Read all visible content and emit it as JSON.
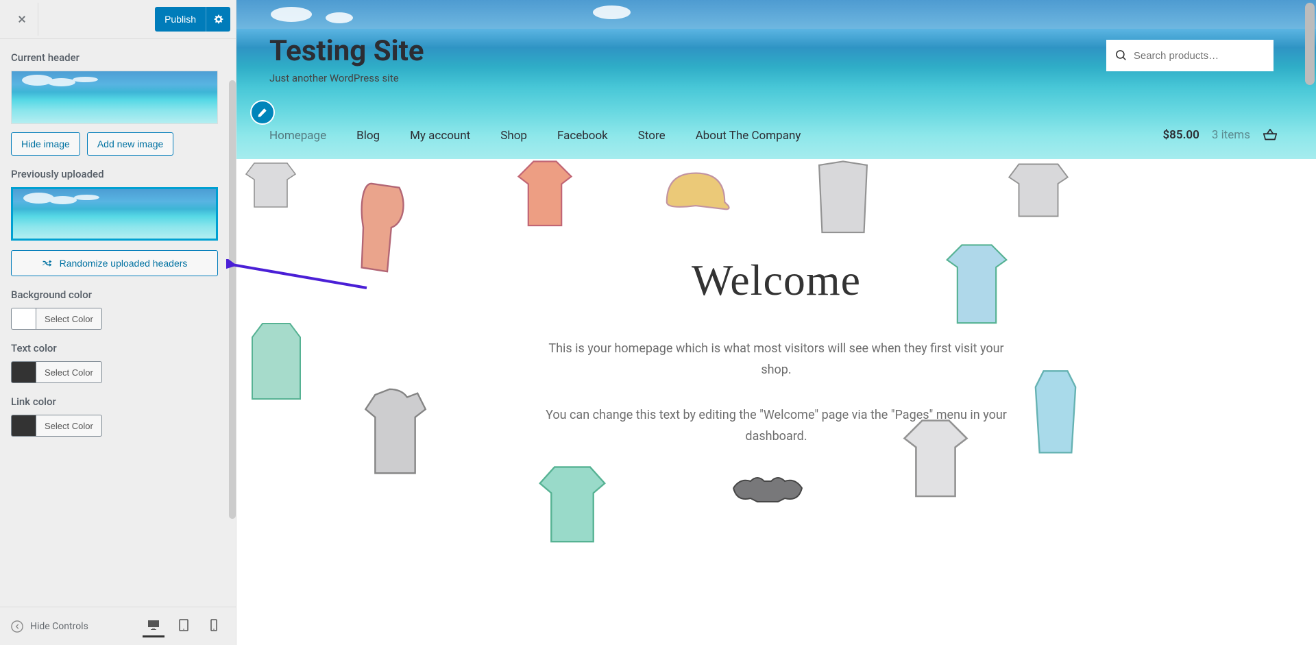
{
  "customizer": {
    "publish_label": "Publish",
    "current_header_label": "Current header",
    "hide_image_label": "Hide image",
    "add_new_image_label": "Add new image",
    "previously_uploaded_label": "Previously uploaded",
    "randomize_label": "Randomize uploaded headers",
    "background_color_label": "Background color",
    "text_color_label": "Text color",
    "link_color_label": "Link color",
    "select_color_label": "Select Color",
    "hide_controls_label": "Hide Controls",
    "colors": {
      "background": "#ffffff",
      "text": "#333333",
      "link": "#333333"
    }
  },
  "site": {
    "title": "Testing Site",
    "tagline": "Just another WordPress site",
    "search_placeholder": "Search products…",
    "nav": [
      {
        "label": "Homepage",
        "active": true
      },
      {
        "label": "Blog"
      },
      {
        "label": "My account"
      },
      {
        "label": "Shop"
      },
      {
        "label": "Facebook"
      },
      {
        "label": "Store"
      },
      {
        "label": "About The Company"
      }
    ],
    "cart": {
      "total": "$85.00",
      "items": "3 items"
    },
    "welcome_title": "Welcome",
    "welcome_p1": "This is your homepage which is what most visitors will see when they first visit your shop.",
    "welcome_p2": "You can change this text by editing the \"Welcome\" page via the \"Pages\" menu in your dashboard."
  }
}
